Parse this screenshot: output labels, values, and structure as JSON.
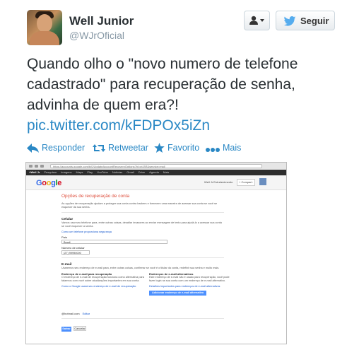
{
  "user": {
    "name": "Well Junior",
    "handle": "@WJrOficial"
  },
  "buttons": {
    "follow_label": "Seguir"
  },
  "tweet": {
    "text": "Quando olho o \"novo numero de telefone cadastrado\" para recuperação de senha, advinha de quem era?!",
    "link": "pic.twitter.com/kFDPOx5iZn"
  },
  "actions": {
    "reply": "Responder",
    "retweet": "Retweetar",
    "favorite": "Favorito",
    "more": "Mais"
  },
  "screenshot": {
    "url": "https://accounts.google.com/b/0/UpdateAccountRecoveryOptions?hl=pt-BR&service=mail",
    "gbar": [
      "+Well Jr",
      "Pesquisar",
      "Imagens",
      "Maps",
      "Play",
      "YouTube",
      "Notícias",
      "Gmail",
      "Drive",
      "Agenda",
      "Mais"
    ],
    "logo": "Google",
    "account_name": "Well Jr Entretenimento",
    "share_label": "+ Compart.",
    "title": "Opções de recuperação de conta",
    "intro": "As opções de recuperação ajudam a proteger sua conta contra hackers e fornecem uma maneira de acessar sua conta se você se esquecer da sua senha.",
    "phone_heading": "Celular",
    "phone_text": "Vamos usar seu telefone para, entre outras coisas, desafiar invasores ao enviar mensagem de texto para ajudá-lo a acessar sua conta se você esquecer a senha.",
    "phone_link": "Como um telefone proporciona segurança",
    "country_label": "País",
    "country_value": "Brasil",
    "phone_label": "Número de celular",
    "phone_value": "(27) 99990000",
    "email_heading": "E-mail",
    "email_text": "Usaremos seu endereço de e-mail para, entre outras coisas, confirmar se você é o titular da conta, redefinir sua senha e muito mais.",
    "recovery_heading": "Endereço de e-mail para recuperação",
    "recovery_text": "O endereço de e-mail de recuperação funciona como alternativa para falarmos com você sobre atualizações importantes em sua conta.",
    "recovery_link": "Como o Google usará seu endereço de e-mail de recuperação",
    "alt_heading": "Endereços de e-mail alternativos",
    "alt_text": "Este endereço de e-mail não é usado para recuperação, você pode fazer login na sua conta com um endereço de e-mail alternativo.",
    "alt_link": "Detalhes importantes para endereços de e-mail alternativos",
    "alt_button": "Adicionar endereço de e-mail alternativo",
    "email_value": "@hotmail.com",
    "email_edit": "Editar",
    "save_label": "Salvar",
    "cancel_label": "Cancelar"
  },
  "colors": {
    "link": "#2a88c5",
    "twitter_blue": "#55acee",
    "google_red": "#dd4b39"
  }
}
